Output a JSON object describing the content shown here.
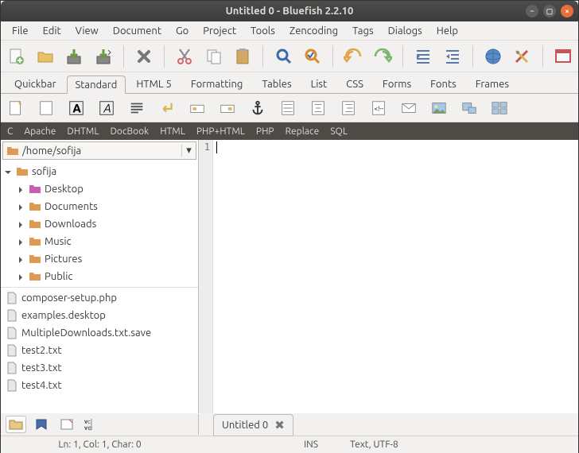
{
  "window": {
    "title": "Untitled 0 - Bluefish 2.2.10"
  },
  "menubar": [
    "File",
    "Edit",
    "View",
    "Document",
    "Go",
    "Project",
    "Tools",
    "Zencoding",
    "Tags",
    "Dialogs",
    "Help"
  ],
  "editor_tabs": [
    "Quickbar",
    "Standard",
    "HTML 5",
    "Formatting",
    "Tables",
    "List",
    "CSS",
    "Forms",
    "Fonts",
    "Frames"
  ],
  "editor_tabs_active": 1,
  "langbar": [
    "C",
    "Apache",
    "DHTML",
    "DocBook",
    "HTML",
    "PHP+HTML",
    "PHP",
    "Replace",
    "SQL"
  ],
  "sidebar": {
    "path": "/home/sofija",
    "root": "sofija",
    "folders": [
      "Desktop",
      "Documents",
      "Downloads",
      "Music",
      "Pictures",
      "Public"
    ],
    "files": [
      "composer-setup.php",
      "examples.desktop",
      "MultipleDownloads.txt.save",
      "test2.txt",
      "test3.txt",
      "test4.txt"
    ]
  },
  "editor": {
    "line_number": "1",
    "doc_tab": "Untitled 0"
  },
  "statusbar": {
    "position": "Ln: 1, Col: 1, Char: 0",
    "mode": "INS",
    "encoding": "Text, UTF-8"
  }
}
